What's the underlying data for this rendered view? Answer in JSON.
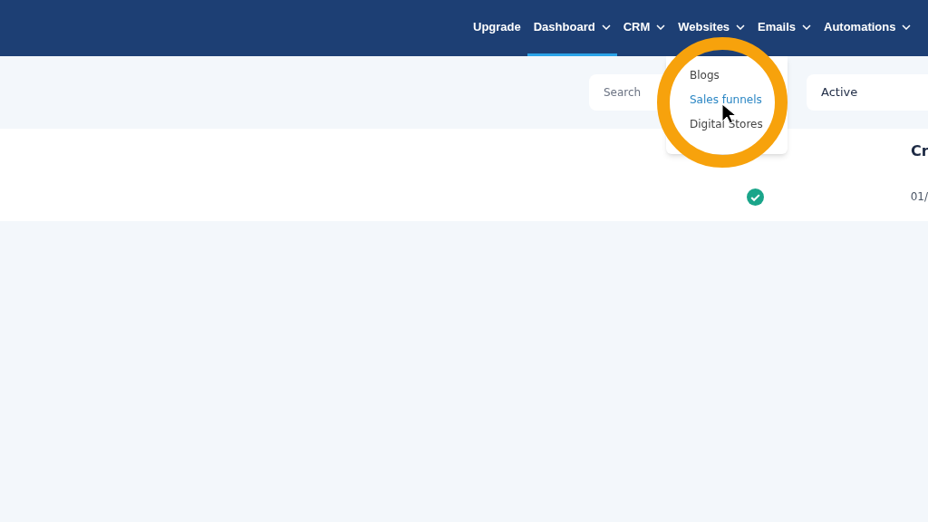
{
  "nav": [
    {
      "label": "Upgrade",
      "dropdown": false,
      "selected": false
    },
    {
      "label": "Dashboard",
      "dropdown": true,
      "selected": true
    },
    {
      "label": "CRM",
      "dropdown": true,
      "selected": false
    },
    {
      "label": "Websites",
      "dropdown": true,
      "selected": false
    },
    {
      "label": "Emails",
      "dropdown": true,
      "selected": false
    },
    {
      "label": "Automations",
      "dropdown": true,
      "selected": false
    }
  ],
  "filters": {
    "search": {
      "placeholder": "Search"
    },
    "status_select": {
      "value": "Active"
    }
  },
  "dropdown_menu": [
    {
      "label": "Blogs",
      "selected": false
    },
    {
      "label": "Sales funnels",
      "selected": true
    },
    {
      "label": "Digital Stores",
      "selected": false
    }
  ],
  "table": {
    "columns": [
      "Cr"
    ],
    "rows": [
      {
        "active": true,
        "column_2": "01/"
      }
    ]
  }
}
